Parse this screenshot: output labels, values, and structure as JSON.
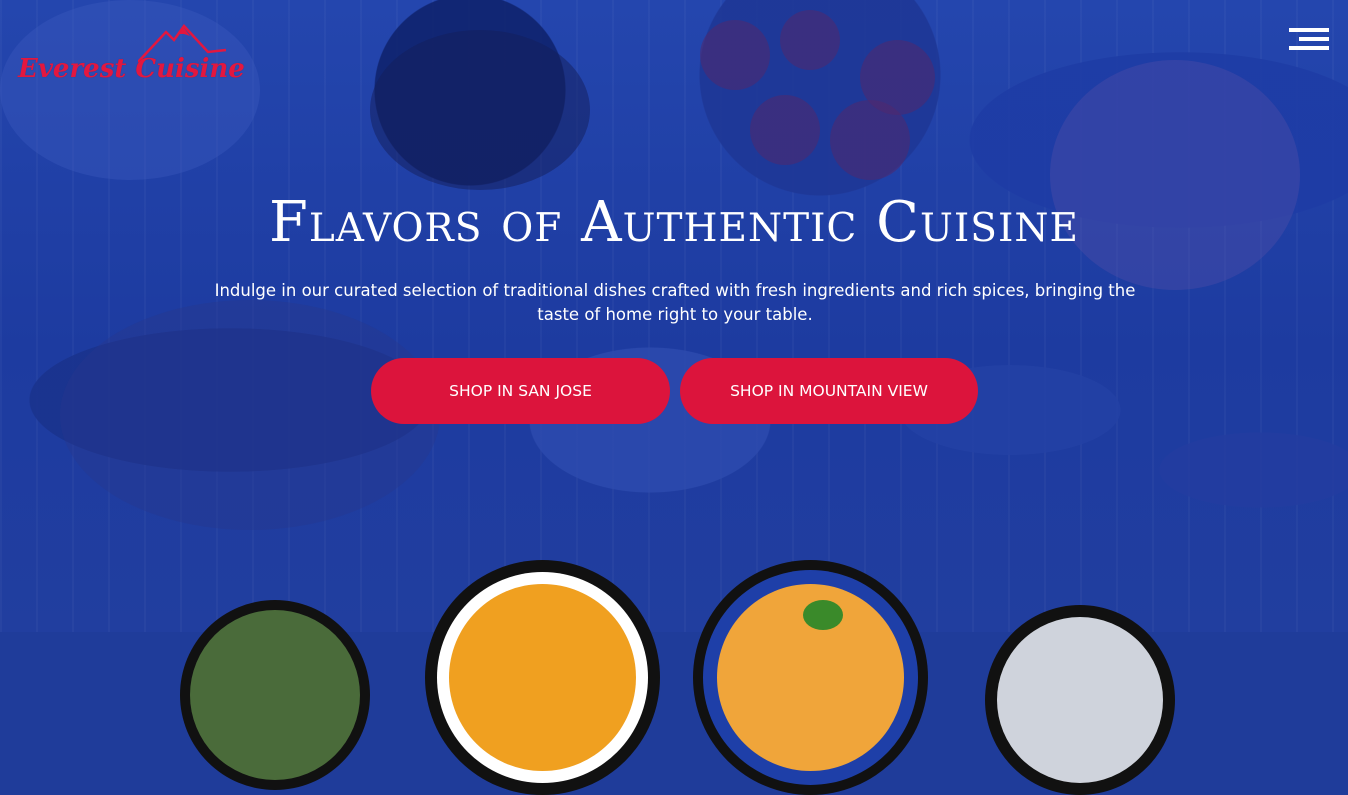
{
  "brand": {
    "name": "Everest Cuisine",
    "color": "#e3173f"
  },
  "header": {
    "menu_icon": "hamburger-menu-icon"
  },
  "hero": {
    "title": "Flavors of Authentic Cuisine",
    "subtitle": "Indulge in our curated selection of traditional dishes crafted with fresh ingredients and rich spices, bringing the taste of home right to your table.",
    "buttons": [
      {
        "label": "SHOP IN SAN JOSE"
      },
      {
        "label": "SHOP IN MOUNTAIN VIEW"
      }
    ]
  },
  "colors": {
    "accent": "#dc143c",
    "overlay": "#1f3c9a"
  }
}
